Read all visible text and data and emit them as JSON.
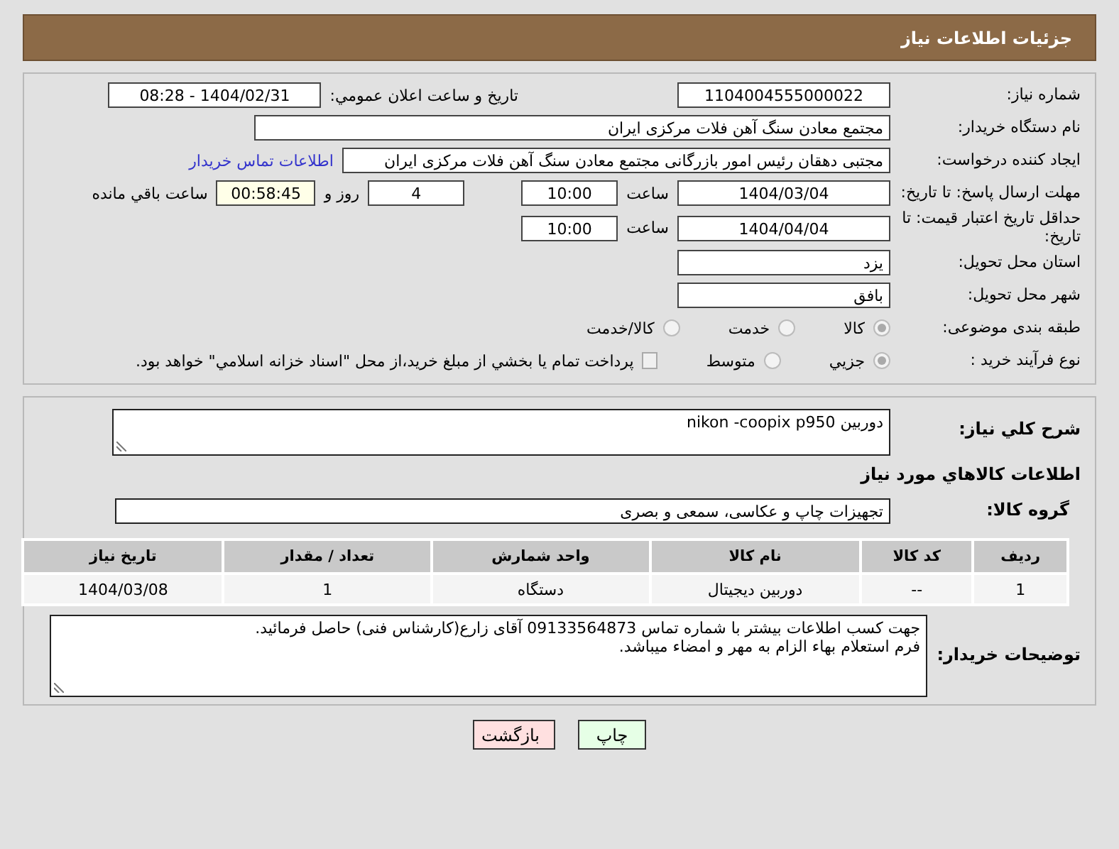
{
  "header": {
    "title": "جزئیات اطلاعات نیاز"
  },
  "need_number": {
    "label": "شماره نیاز:",
    "value": "1104004555000022"
  },
  "announce": {
    "label": "تاریخ و ساعت اعلان عمومي:",
    "value": "1404/02/31 - 08:28"
  },
  "buyer_org": {
    "label": "نام دستگاه خريدار:",
    "value": "مجتمع معادن سنگ آهن فلات مرکزی ایران"
  },
  "requester": {
    "label": "ايجاد کننده درخواست:",
    "value": "مجتبی  دهقان رئیس امور بازرگانی مجتمع معادن سنگ آهن فلات مرکزی ایران",
    "link": "اطلاعات تماس خريدار"
  },
  "reply_deadline": {
    "label": "مهلت ارسال پاسخ: تا تاريخ:",
    "date": "1404/03/04",
    "time_label": "ساعت",
    "time": "10:00",
    "days": "4",
    "days_label": "روز و",
    "remaining": "00:58:45",
    "remaining_label": "ساعت باقي مانده"
  },
  "price_validity": {
    "label": "حداقل تاريخ اعتبار قيمت: تا تاريخ:",
    "date": "1404/04/04",
    "time_label": "ساعت",
    "time": "10:00"
  },
  "province": {
    "label": "استان محل تحويل:",
    "value": "یزد"
  },
  "city": {
    "label": "شهر محل تحويل:",
    "value": "بافق"
  },
  "category": {
    "label": "طبقه بندی موضوعی:",
    "options": [
      {
        "label": "کالا",
        "selected": true
      },
      {
        "label": "خدمت",
        "selected": false
      },
      {
        "label": "کالا/خدمت",
        "selected": false
      }
    ]
  },
  "process": {
    "label": "نوع فرآيند خريد :",
    "options": [
      {
        "label": "جزيي",
        "selected": true
      },
      {
        "label": "متوسط",
        "selected": false
      }
    ],
    "payment": {
      "label": "پرداخت تمام يا بخشي از مبلغ خريد،از محل \"اسناد خزانه اسلامي\" خواهد بود.",
      "checked": false
    }
  },
  "description": {
    "label": "شرح کلي نياز:",
    "value": "دوربین nikon -coopix p950"
  },
  "goods_heading": "اطلاعات کالاهاي مورد نياز",
  "goods_group": {
    "label": "گروه کالا:",
    "value": "تجهیزات چاپ و عکاسی، سمعی و بصری"
  },
  "table": {
    "columns": [
      "رديف",
      "کد کالا",
      "نام کالا",
      "واحد شمارش",
      "تعداد / مقدار",
      "تاريخ نياز"
    ],
    "rows": [
      [
        "1",
        "--",
        "دوربین دیجیتال",
        "دستگاه",
        "1",
        "1404/03/08"
      ]
    ]
  },
  "buyer_notes": {
    "label": "توضيحات خريدار:",
    "lines": [
      "جهت کسب اطلاعات بیشتر با شماره تماس 09133564873 آقای زارع(کارشناس فنی) حاصل فرمائید.",
      "فرم استعلام بهاء الزام به مهر و امضاء میباشد."
    ]
  },
  "buttons": [
    {
      "label": "چاپ",
      "kind": "print"
    },
    {
      "label": "بازگشت",
      "kind": "back"
    }
  ]
}
